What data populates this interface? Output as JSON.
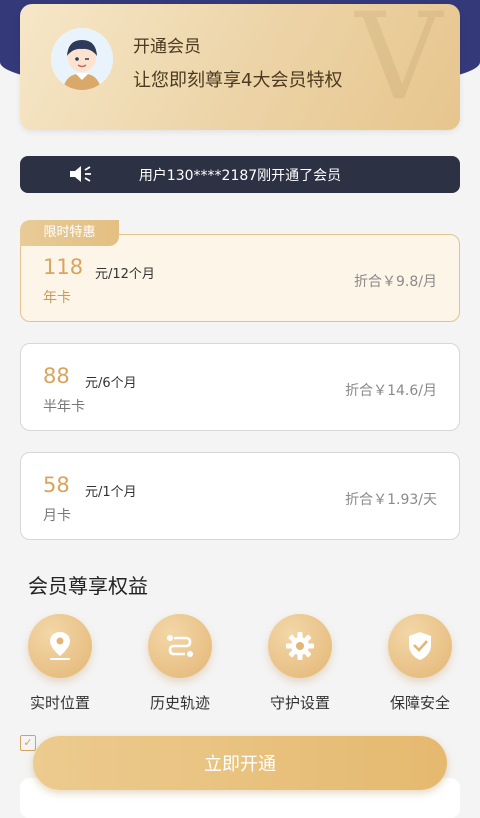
{
  "header": {
    "title": "开通会员",
    "subtitle": "让您即刻尊享4大会员特权",
    "watermark": "V"
  },
  "notice": {
    "text": "用户130****2187刚开通了会员",
    "icon": "speaker-icon"
  },
  "badge": "限时特惠",
  "plans": [
    {
      "price": "118",
      "unit": "元/12个月",
      "name": "年卡",
      "per": "折合￥9.8/月"
    },
    {
      "price": "88",
      "unit": "元/6个月",
      "name": "半年卡",
      "per": "折合￥14.6/月"
    },
    {
      "price": "58",
      "unit": "元/1个月",
      "name": "月卡",
      "per": "折合￥1.93/天"
    }
  ],
  "benefits": {
    "title": "会员尊享权益",
    "items": [
      {
        "label": "实时位置",
        "icon": "location-pin-icon"
      },
      {
        "label": "历史轨迹",
        "icon": "route-icon"
      },
      {
        "label": "守护设置",
        "icon": "gear-icon"
      },
      {
        "label": "保障安全",
        "icon": "shield-check-icon"
      }
    ]
  },
  "agree_checked": true,
  "cta": "立即开通",
  "colors": {
    "navy": "#34397a",
    "gold": "#e5b96f",
    "dark_bar": "#2d3144"
  }
}
